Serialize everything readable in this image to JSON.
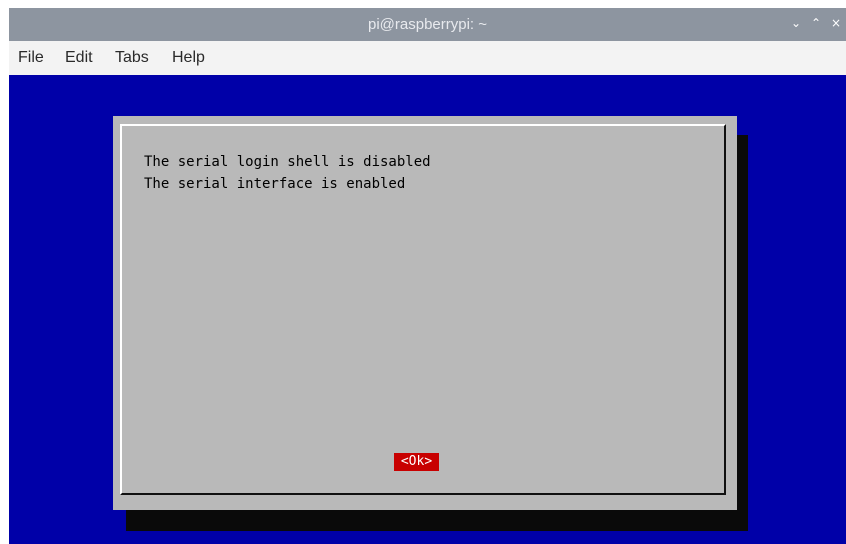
{
  "window": {
    "title": "pi@raspberrypi: ~",
    "controls": {
      "minimize": "⌄",
      "maximize": "⌃",
      "close": "×"
    }
  },
  "menu": {
    "items": [
      "File",
      "Edit",
      "Tabs",
      "Help"
    ]
  },
  "colors": {
    "terminal_bg": "#0000a8",
    "dialog_bg": "#b9b9b9",
    "button_bg": "#c80000"
  },
  "dialog": {
    "messages": [
      "The serial login shell is disabled",
      "The serial interface is enabled"
    ],
    "ok_label": "<Ok>"
  }
}
